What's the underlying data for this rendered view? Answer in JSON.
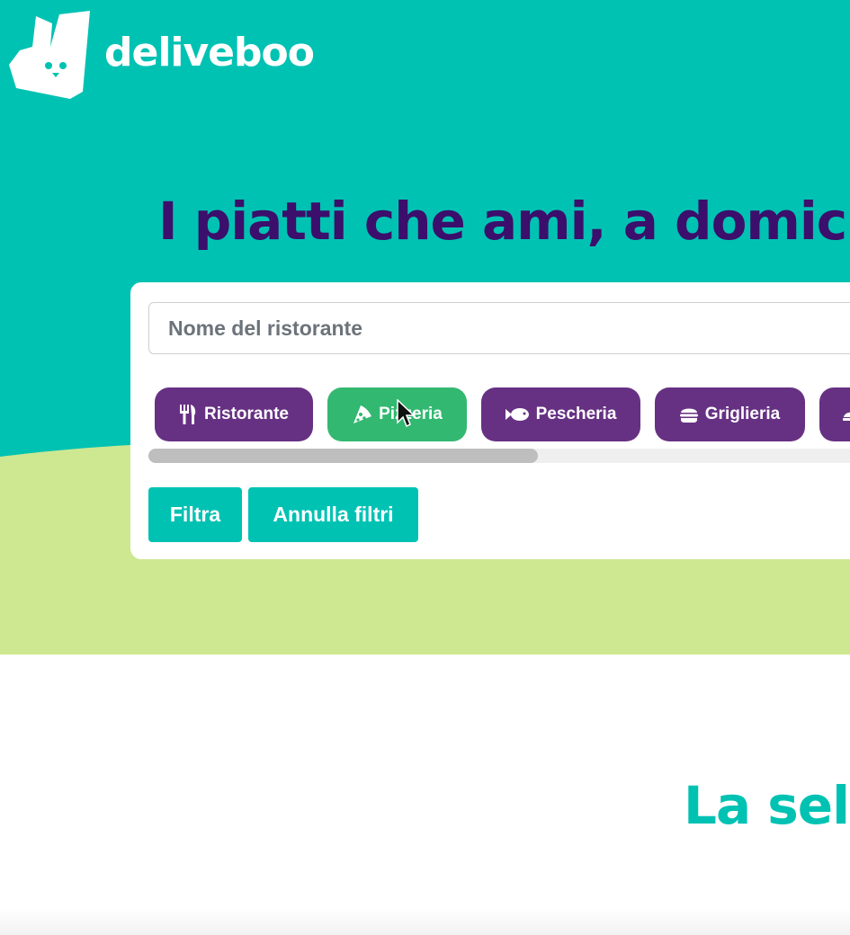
{
  "brand": {
    "name": "deliveboo"
  },
  "hero": {
    "headline": "I piatti che ami, a domicili"
  },
  "search": {
    "placeholder": "Nome del ristorante",
    "value": ""
  },
  "categories": [
    {
      "label": "Ristorante",
      "icon": "utensils-icon",
      "active": false
    },
    {
      "label": "Pizzeria",
      "icon": "pizza-slice-icon",
      "active": true
    },
    {
      "label": "Pescheria",
      "icon": "fish-icon",
      "active": false
    },
    {
      "label": "Griglieria",
      "icon": "burger-icon",
      "active": false
    },
    {
      "label": "",
      "icon": "category-icon",
      "active": false
    }
  ],
  "actions": {
    "filter_label": "Filtra",
    "reset_label": "Annulla filtri"
  },
  "section": {
    "title": "La sele"
  },
  "colors": {
    "teal": "#00c2b3",
    "lime": "#cde891",
    "purple_text": "#3b0f6b",
    "chip_purple": "#673183",
    "chip_active": "#33b871"
  }
}
